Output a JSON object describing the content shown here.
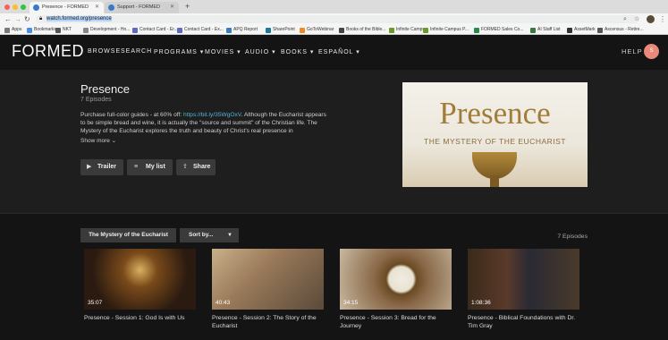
{
  "browser": {
    "tabs": [
      {
        "label": "Presence - FORMED"
      },
      {
        "label": "Support - FORMED"
      }
    ],
    "new_tab": "+",
    "url_selected": "watch.formed.org/presence",
    "bookmarks": [
      {
        "label": "Apps",
        "color": "#7a7a7a"
      },
      {
        "label": "Bookmarks",
        "color": "#4a8fe0"
      },
      {
        "label": "NKT",
        "color": "#555555"
      },
      {
        "label": "Development - Ho...",
        "color": "#888888"
      },
      {
        "label": "Contact Card - Er...",
        "color": "#5b6bc0"
      },
      {
        "label": "Contact Card - Ex...",
        "color": "#5b6bc0"
      },
      {
        "label": "APQ Report",
        "color": "#3c7dbd"
      },
      {
        "label": "SharePoint",
        "color": "#1a7a9a"
      },
      {
        "label": "GoToWebinar",
        "color": "#f08a24"
      },
      {
        "label": "Books of the Bible...",
        "color": "#444444"
      },
      {
        "label": "Infinite Campus",
        "color": "#6a9a2a"
      },
      {
        "label": "Infinite Campus P...",
        "color": "#6a9a2a"
      },
      {
        "label": "FORMED Sales Co...",
        "color": "#2a8a4a"
      },
      {
        "label": "AI Staff List",
        "color": "#3a7a3a"
      },
      {
        "label": "AssetMark",
        "color": "#333333"
      },
      {
        "label": "Ascensus - Retire...",
        "color": "#555555"
      }
    ]
  },
  "nav": {
    "logo": "FORMED",
    "items": [
      "BROWSE",
      "SEARCH",
      "PROGRAMS ▾",
      "MOVIES ▾",
      "AUDIO ▾",
      "BOOKS ▾",
      "ESPAÑOL ▾"
    ],
    "help": "HELP",
    "avatar": "S"
  },
  "hero": {
    "title": "Presence",
    "episodes": "7 Episodes",
    "desc_prefix": "Purchase full-color guides - at 60% off: ",
    "desc_link": "https://bit.ly/35WgOxV",
    "desc_rest": ". Although the Eucharist appears to be simple bread and wine, it is actually the \"source and summit\" of the Christian life. The Mystery of the Eucharist explores the truth and beauty of Christ's real presence in",
    "show_more": "Show more  ⌄",
    "buttons": {
      "trailer": "Trailer",
      "mylist": "My list",
      "share": "Share"
    },
    "poster": {
      "wordmark": "Presence",
      "subtitle": "THE MYSTERY OF THE EUCHARIST"
    }
  },
  "season": {
    "selected": "The Mystery of the Eucharist",
    "sort": "Sort by...",
    "count": "7 Episodes"
  },
  "episodes": [
    {
      "duration": "35:07",
      "title": "Presence - Session 1: God Is with Us"
    },
    {
      "duration": "40:43",
      "title": "Presence - Session 2: The Story of the Eucharist"
    },
    {
      "duration": "34:15",
      "title": "Presence - Session 3: Bread for the Journey"
    },
    {
      "duration": "1:08:36",
      "title": "Presence - Biblical Foundations with Dr. Tim Gray"
    }
  ]
}
